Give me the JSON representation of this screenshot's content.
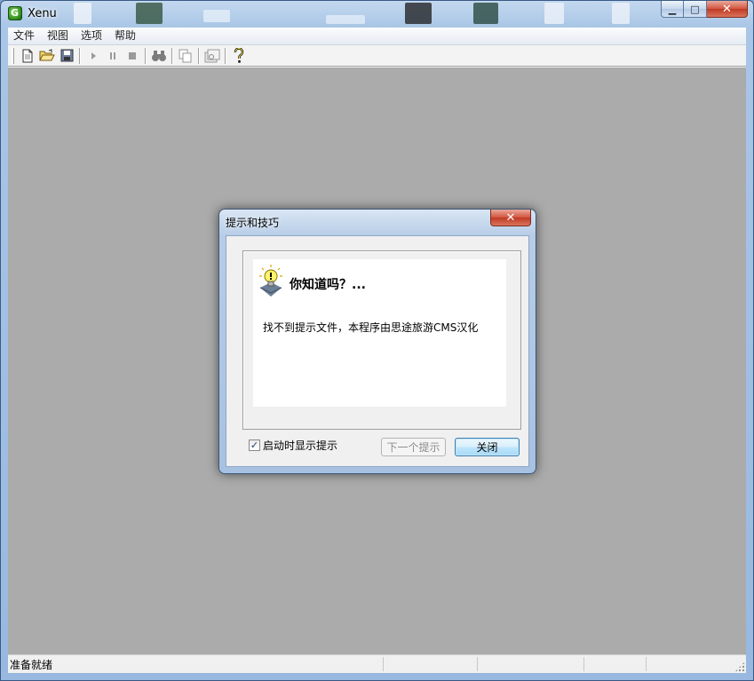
{
  "window": {
    "title": "Xenu",
    "app_icon_glyph": "G",
    "minimize_glyph": "▁",
    "maximize_glyph": "□",
    "close_glyph": "✕"
  },
  "menu": {
    "items": [
      "文件",
      "视图",
      "选项",
      "帮助"
    ]
  },
  "toolbar": {
    "icons": [
      "new-document-icon",
      "open-folder-icon",
      "save-icon",
      "play-icon",
      "pause-icon",
      "stop-icon",
      "binoculars-icon",
      "copy-icon",
      "properties-icon",
      "help-icon"
    ]
  },
  "status": {
    "text": "准备就绪"
  },
  "dialog": {
    "title": "提示和技巧",
    "close_glyph": "✕",
    "heading": "你知道吗？...",
    "tip": "找不到提示文件，本程序由思途旅游CMS汉化",
    "checkbox_label": "启动时显示提示",
    "checkbox_checked": true,
    "checkbox_glyph": "✓",
    "next_button": "下一个提示",
    "close_button": "关闭"
  },
  "colors": {
    "mdi_background": "#ababab",
    "close_red": "#c03a24",
    "title_blue": "#a9c6e6"
  }
}
